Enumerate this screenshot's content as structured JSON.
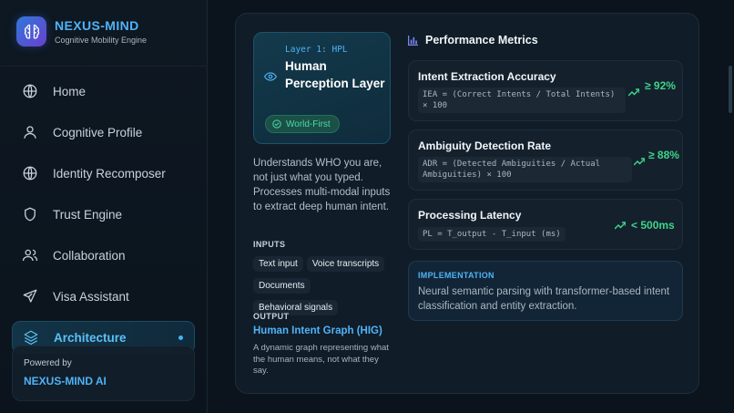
{
  "brand": {
    "title": "NEXUS-MIND",
    "subtitle": "Cognitive Mobility Engine",
    "logo_icon": "brain-icon"
  },
  "sidebar": {
    "items": [
      {
        "label": "Home",
        "icon": "globe-icon",
        "active": false
      },
      {
        "label": "Cognitive Profile",
        "icon": "user-icon",
        "active": false
      },
      {
        "label": "Identity Recomposer",
        "icon": "globe-icon",
        "active": false
      },
      {
        "label": "Trust Engine",
        "icon": "shield-icon",
        "active": false
      },
      {
        "label": "Collaboration",
        "icon": "users-icon",
        "active": false
      },
      {
        "label": "Visa Assistant",
        "icon": "plane-icon",
        "active": false
      },
      {
        "label": "Architecture",
        "icon": "layers-icon",
        "active": true
      }
    ],
    "powered_by": {
      "label": "Powered by",
      "name": "NEXUS-MIND AI"
    }
  },
  "layer": {
    "tag": "Layer 1: HPL",
    "name": "Human Perception Layer",
    "badge": "World-First",
    "description": "Understands WHO you are, not just what you typed. Processes multi-modal inputs to extract deep human intent.",
    "inputs_heading": "INPUTS",
    "inputs": [
      "Text input",
      "Voice transcripts",
      "Documents",
      "Behavioral signals"
    ],
    "output_heading": "OUTPUT",
    "output_name": "Human Intent Graph (HIG)",
    "output_description": "A dynamic graph representing what the human means, not what they say."
  },
  "metrics": {
    "title": "Performance Metrics",
    "items": [
      {
        "name": "Intent Extraction Accuracy",
        "formula": "IEA = (Correct Intents / Total Intents) × 100",
        "value": "≥ 92%"
      },
      {
        "name": "Ambiguity Detection Rate",
        "formula": "ADR = (Detected Ambiguities / Actual Ambiguities) × 100",
        "value": "≥ 88%"
      },
      {
        "name": "Processing Latency",
        "formula": "PL = T_output - T_input (ms)",
        "value": "< 500ms"
      }
    ]
  },
  "implementation": {
    "heading": "IMPLEMENTATION",
    "text": "Neural semantic parsing with transformer-based intent classification and entity extraction."
  },
  "colors": {
    "accent": "#4fb3f7",
    "success": "#3fd38a",
    "badge_text": "#4ed8a8"
  }
}
